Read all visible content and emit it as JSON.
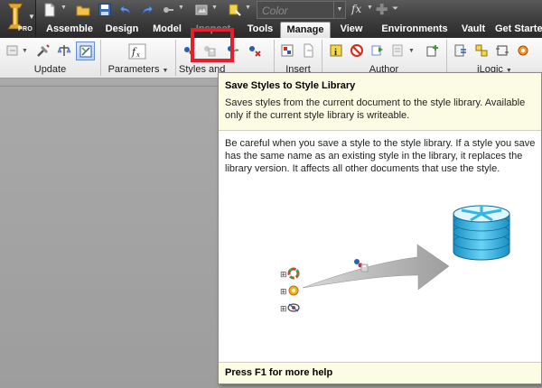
{
  "app": {
    "logo_icon": "autodesk-inventor-logo-icon",
    "edition_badge": "PRO"
  },
  "quick_access": {
    "icons": [
      "new-file-icon",
      "open-folder-icon",
      "save-icon",
      "undo-icon",
      "redo-icon",
      "select-icon",
      "appearance-icon",
      "update-icon"
    ],
    "color_placeholder": "Color",
    "fx_label": "fx"
  },
  "tabs": [
    {
      "label": "Assemble",
      "active": false
    },
    {
      "label": "Design",
      "active": false
    },
    {
      "label": "Model",
      "active": false
    },
    {
      "label": "Inspect",
      "active": false
    },
    {
      "label": "Tools",
      "active": false
    },
    {
      "label": "Manage",
      "active": true
    },
    {
      "label": "View",
      "active": false
    },
    {
      "label": "Environments",
      "active": false
    },
    {
      "label": "Vault",
      "active": false
    },
    {
      "label": "Get Started",
      "active": false
    }
  ],
  "ribbon": {
    "panels": [
      {
        "title": "Update"
      },
      {
        "title": "Parameters",
        "has_dropdown": true
      },
      {
        "title": "Styles and Standards"
      },
      {
        "title": "Insert"
      },
      {
        "title": "Author",
        "has_dropdown": true
      },
      {
        "title": "iLogic",
        "has_dropdown": true
      }
    ],
    "buttons": {
      "update": [
        "update-icon",
        "rebuild-all-icon",
        "update-mass-icon"
      ],
      "parameters": [
        "parameters-fx-icon"
      ],
      "styles": [
        "update-styles-icon",
        "save-styles-icon",
        "purge-styles-icon",
        "style-editor-icon"
      ],
      "insert": [
        "insert-object-icon",
        "import-icon"
      ],
      "author": [
        "author-info-icon",
        "no-icon",
        "publish-icon",
        "author-dropdown-icon"
      ],
      "ilogic": [
        "add-rule-icon",
        "event-triggers-icon",
        "ilogic-browser-icon",
        "settings-icon"
      ]
    }
  },
  "tooltip": {
    "title": "Save Styles to Style Library",
    "short_desc": "Saves styles from the current document to the style library. Available only if the current style library is writeable.",
    "long_desc": "Be careful when you save a style to the style library. If a style you save has the same name as an existing style in the library, it replaces the library version. It affects all other documents that use the style.",
    "footer": "Press F1 for more help",
    "illustration": {
      "items": [
        "color-wheel-icon",
        "material-icon",
        "lighting-icon"
      ],
      "destination": "style-library-database-icon",
      "command_icon": "save-styles-icon"
    }
  },
  "colors": {
    "highlight": "#e5202a",
    "tooltip_bg": "#fcfbe3",
    "database": "#2fb4e2"
  }
}
